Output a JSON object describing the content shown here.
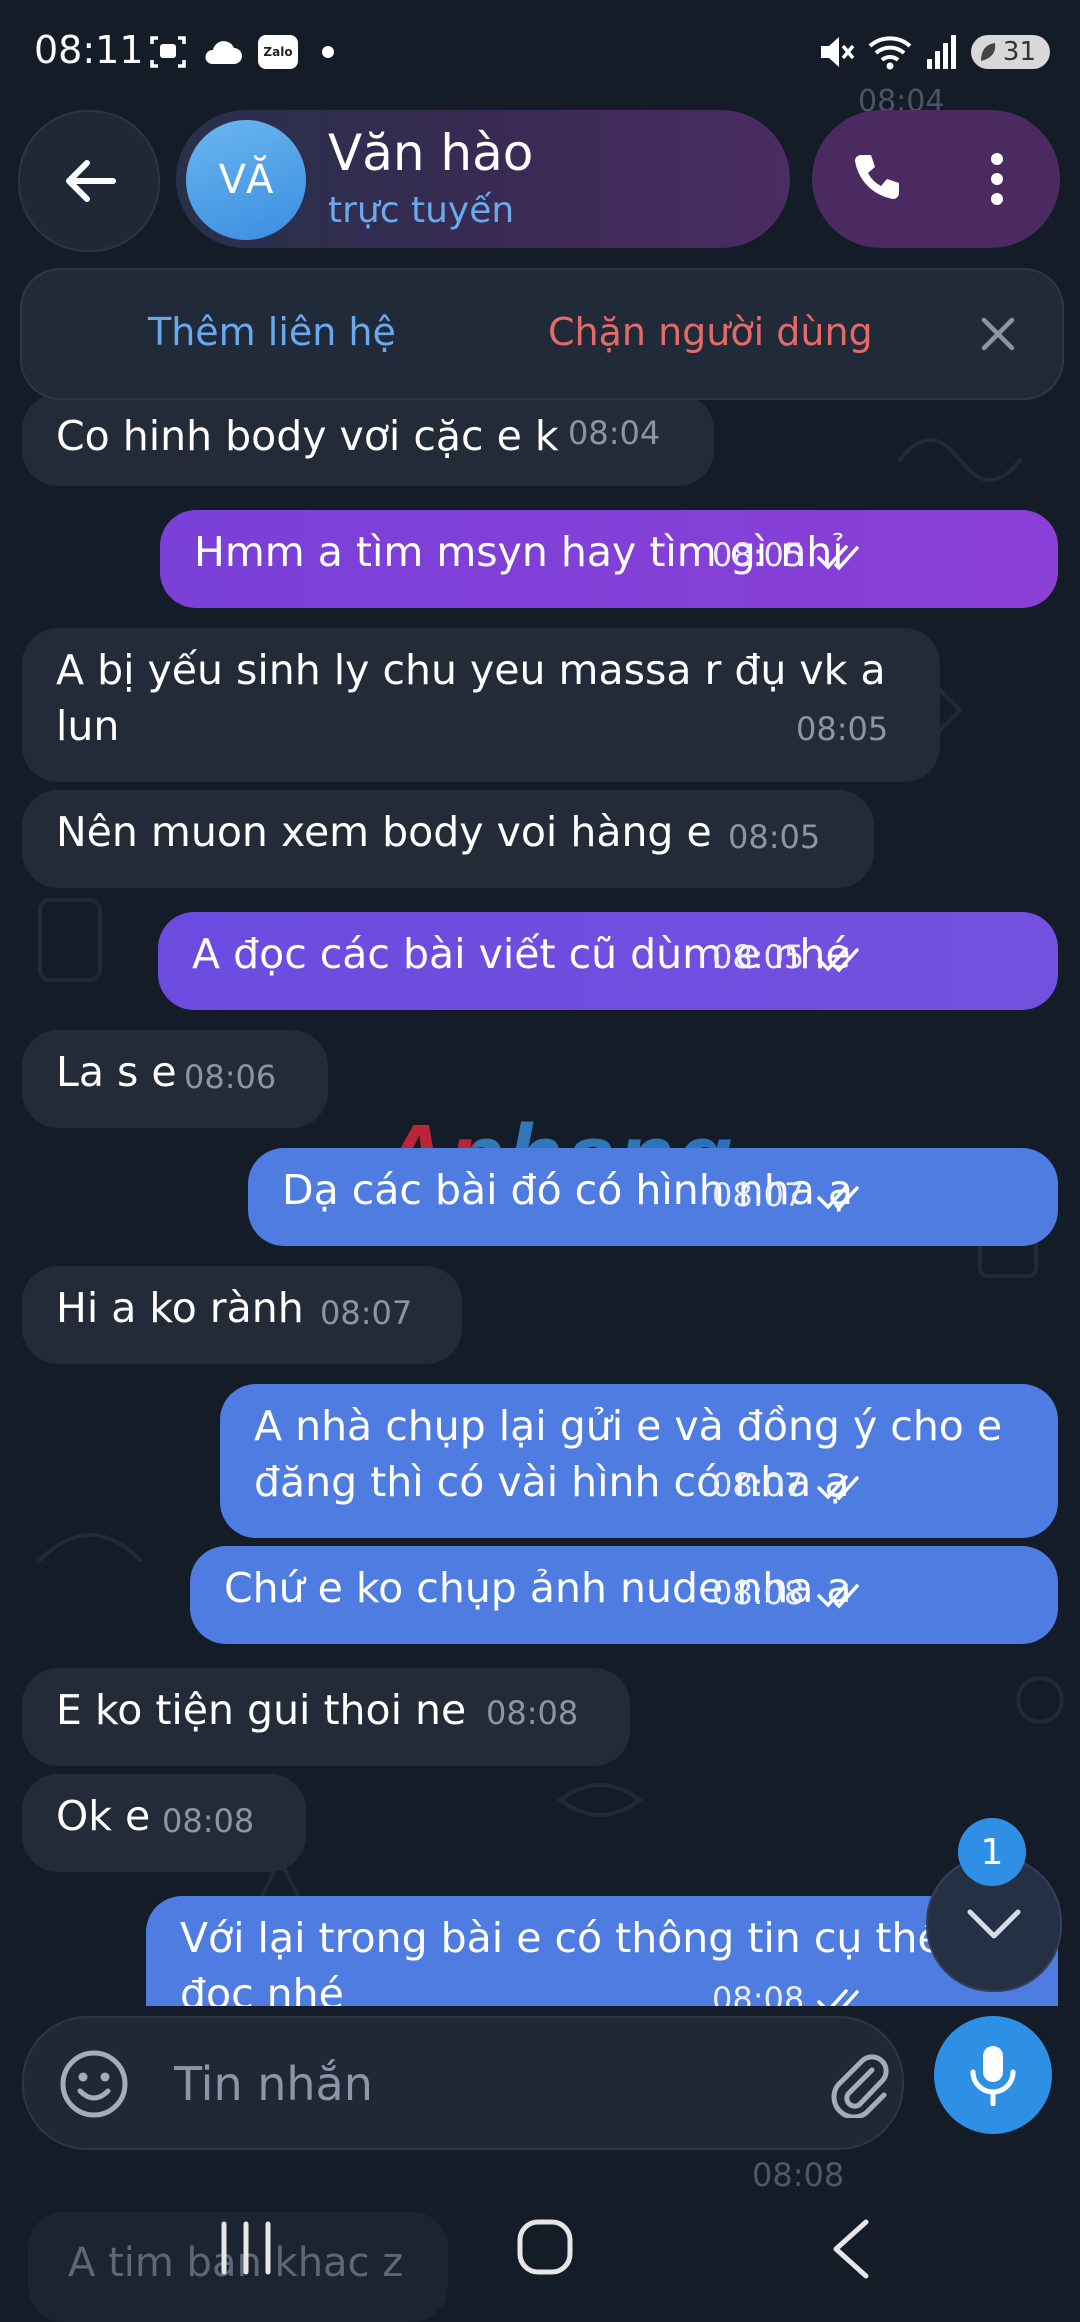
{
  "status_bar": {
    "time": "08:11",
    "zalo_label": "Zalo",
    "battery": "31",
    "icons": [
      "screenshot-icon",
      "cloud-icon",
      "zalo-icon",
      "notification-dot",
      "mute-icon",
      "wifi-icon",
      "signal-icon",
      "battery-icon"
    ]
  },
  "header": {
    "avatar_initials": "VĂ",
    "name": "Văn hào",
    "status": "trực tuyến"
  },
  "banner": {
    "add_contact": "Thêm liên hệ",
    "block_user": "Chặn người dùng"
  },
  "messages": [
    {
      "dir": "in",
      "text": "Co hinh body vơi cặc e k",
      "time": "08:04"
    },
    {
      "dir": "out",
      "text": "Hmm a tìm msyn hay tìm gì nhỉ",
      "time": "08:05"
    },
    {
      "dir": "in",
      "text": "A bị yếu sinh ly chu yeu massa r đụ vk a\nlun",
      "time": "08:05"
    },
    {
      "dir": "in",
      "text": "Nên muon xem body voi hàng e",
      "time": "08:05"
    },
    {
      "dir": "out",
      "text": "A đọc các bài viết cũ dùm e nhé",
      "time": "08:05"
    },
    {
      "dir": "in",
      "text": "La s e",
      "time": "08:06"
    },
    {
      "dir": "out",
      "text": "Dạ các bài đó có hình nha ạ",
      "time": "08:07"
    },
    {
      "dir": "in",
      "text": "Hi a ko rành",
      "time": "08:07"
    },
    {
      "dir": "out",
      "text": "A nhà chụp lại gửi e và đồng ý cho e\nđăng thì có vài hình có nha ạ",
      "time": "08:07"
    },
    {
      "dir": "out",
      "text": "Chứ e ko chụp ảnh nude nha a",
      "time": "08:08"
    },
    {
      "dir": "in",
      "text": "E ko tiện gui thoi ne",
      "time": "08:08"
    },
    {
      "dir": "in",
      "text": "Ok e",
      "time": "08:08"
    },
    {
      "dir": "out",
      "text": "Với lại trong bài e có thông tin cụ thể\nđọc nhé",
      "time": "08:08"
    }
  ],
  "background_faded": {
    "top_time": "08:04",
    "bottom_time": "08:08",
    "bottom_text": "A tim ban khac z"
  },
  "watermark": "Aphang",
  "composer": {
    "placeholder": "Tin nhắn"
  },
  "scroll_down": {
    "unread_count": "1"
  },
  "colors": {
    "background": "#141c28",
    "incoming_bubble": "#232b38",
    "outgoing_bubble": "#4f7ce0",
    "outgoing_top": "#8a3fd6",
    "accent_blue": "#2e90e4",
    "status_online": "#6aa9ee",
    "block_red": "#e46a6a"
  }
}
